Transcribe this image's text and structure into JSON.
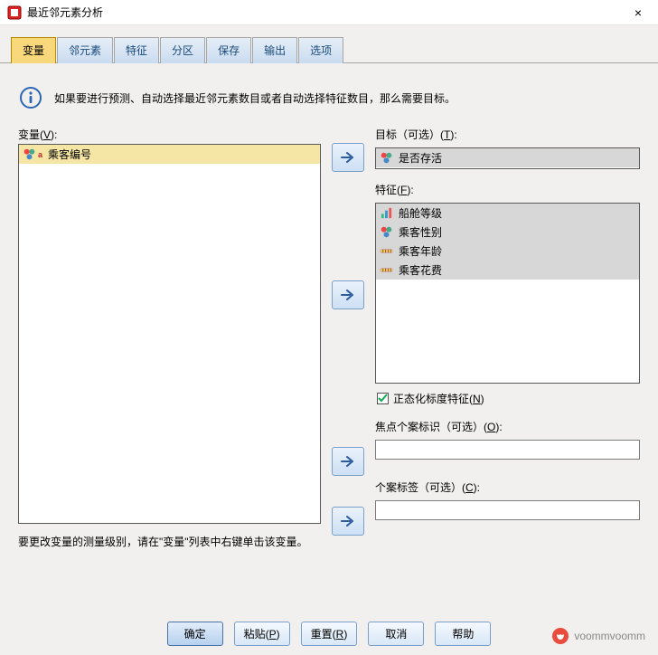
{
  "window": {
    "title": "最近邻元素分析",
    "close": "×"
  },
  "tabs": [
    "变量",
    "邻元素",
    "特征",
    "分区",
    "保存",
    "输出",
    "选项"
  ],
  "active_tab_index": 0,
  "info_text": "如果要进行预测、自动选择最近邻元素数目或者自动选择特征数目，那么需要目标。",
  "left": {
    "label_pre": "变量(",
    "label_key": "V",
    "label_post": "):",
    "items": [
      "乘客编号"
    ],
    "hint": "要更改变量的测量级别，请在\"变量\"列表中右键单击该变量。"
  },
  "right": {
    "target": {
      "label_pre": "目标（可选）(",
      "label_key": "T",
      "label_post": "):",
      "items": [
        "是否存活"
      ]
    },
    "features": {
      "label_pre": "特征(",
      "label_key": "F",
      "label_post": "):",
      "items": [
        "船舱等级",
        "乘客性别",
        "乘客年龄",
        "乘客花费"
      ],
      "checkbox_pre": "正态化标度特征(",
      "checkbox_key": "N",
      "checkbox_post": ")",
      "checkbox_checked": true
    },
    "focal": {
      "label_pre": "焦点个案标识（可选）(",
      "label_key": "O",
      "label_post": "):",
      "value": ""
    },
    "caselabel": {
      "label_pre": "个案标签（可选）(",
      "label_key": "C",
      "label_post": "):",
      "value": ""
    }
  },
  "buttons": {
    "ok": "确定",
    "paste_pre": "粘贴(",
    "paste_key": "P",
    "paste_post": ")",
    "reset_pre": "重置(",
    "reset_key": "R",
    "reset_post": ")",
    "cancel": "取消",
    "help": "帮助"
  },
  "watermark": "voommvoomm"
}
